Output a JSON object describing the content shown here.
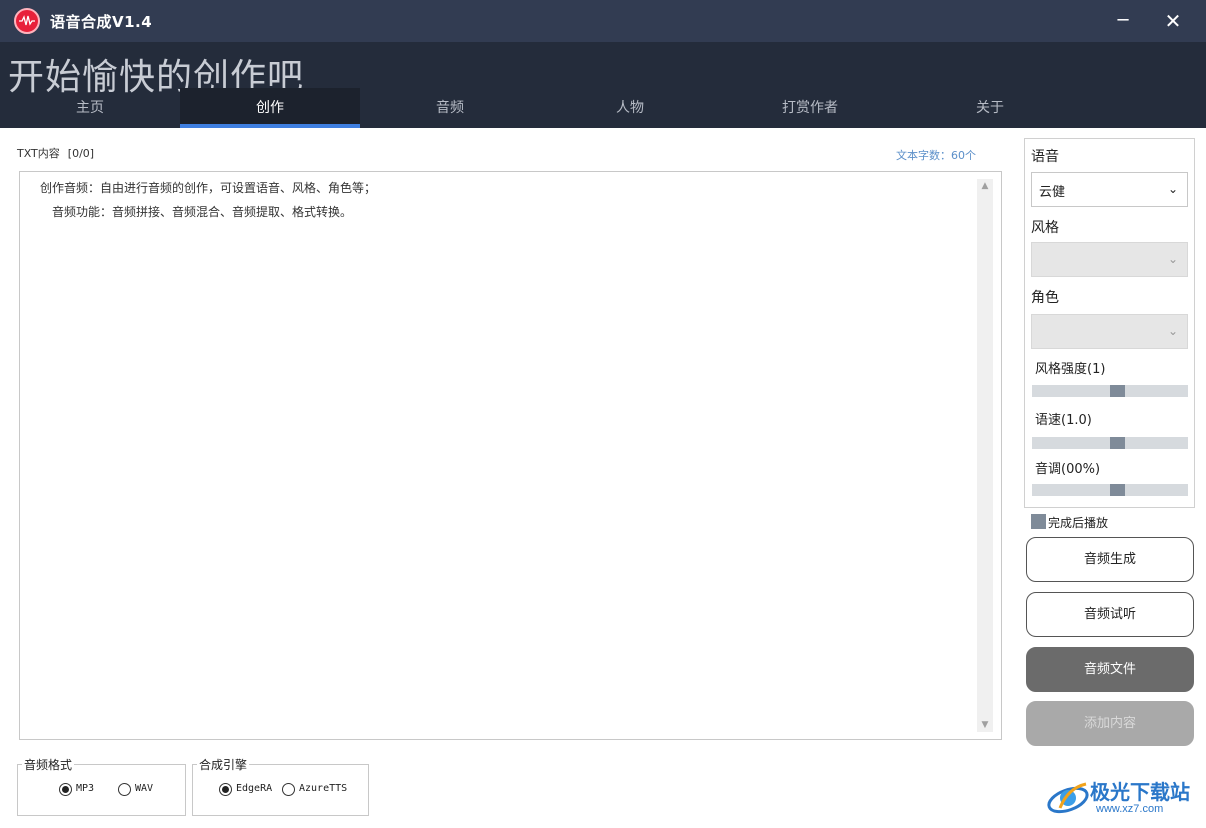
{
  "window": {
    "title": "语音合成V1.4",
    "minimize_glyph": "─",
    "close_glyph": "✕"
  },
  "banner": {
    "slogan": "开始愉快的创作吧"
  },
  "tabs": [
    {
      "label": "主页",
      "active": false
    },
    {
      "label": "创作",
      "active": true
    },
    {
      "label": "音频",
      "active": false
    },
    {
      "label": "人物",
      "active": false
    },
    {
      "label": "打赏作者",
      "active": false
    },
    {
      "label": "关于",
      "active": false
    }
  ],
  "editor": {
    "label": "TXT内容",
    "count": "[0/0]",
    "char_count": "文本字数：60个",
    "lines": [
      "创作音频：自由进行音频的创作，可设置语音、风格、角色等；",
      "音频功能：音频拼接、音频混合、音频提取、格式转换。"
    ]
  },
  "format_group": {
    "title": "音频格式",
    "options": [
      {
        "label": "MP3",
        "checked": true
      },
      {
        "label": "WAV",
        "checked": false
      }
    ]
  },
  "engine_group": {
    "title": "合成引擎",
    "options": [
      {
        "label": "EdgeRA",
        "checked": true
      },
      {
        "label": "AzureTTS",
        "checked": false
      }
    ]
  },
  "panel": {
    "voice_label": "语音",
    "voice_value": "云健",
    "style_label": "风格",
    "style_value": "",
    "role_label": "角色",
    "role_value": "",
    "style_strength_label": "风格强度(1)",
    "style_strength_level": 0.55,
    "speed_label": "语速(1.0)",
    "speed_level": 0.55,
    "pitch_label": "音调(00%)",
    "pitch_level": 0.55,
    "chevron_glyph": "⌄"
  },
  "play_after": {
    "label": "完成后播放",
    "checked": true
  },
  "buttons": {
    "generate": "音频生成",
    "preview": "音频试听",
    "file": "音频文件",
    "add_content": "添加内容"
  },
  "watermark": {
    "title": "极光下载站",
    "url": "www.xz7.com"
  },
  "colors": {
    "titlebar": "#323c52",
    "banner": "#242c3b",
    "tab_accent": "#3f7fe0",
    "app_icon": "#e8203a",
    "slider_thumb": "#7f8b99"
  }
}
